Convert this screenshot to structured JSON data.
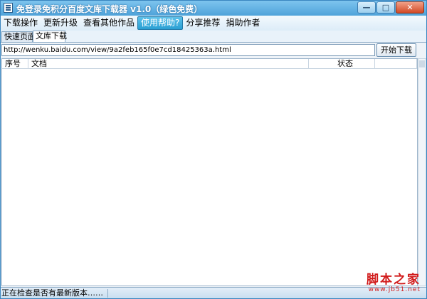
{
  "window": {
    "title": "免登录免积分百度文库下载器 v1.0（绿色免费）",
    "controls": [
      "—",
      "□",
      "✕"
    ]
  },
  "menu": {
    "items": [
      "下载操作",
      "更新升级",
      "查看其他作品",
      "使用帮助?",
      "分享推荐",
      "捐助作者"
    ],
    "active_index": 3
  },
  "tabs": [
    "快速页面",
    "文库下载"
  ],
  "toolbar": {
    "url_value": "http://wenku.baidu.com/view/9a2feb165f0e7cd18425363a.html",
    "start_button": "开始下载"
  },
  "table": {
    "headers": [
      "序号",
      "文档",
      "状态",
      ""
    ],
    "rows": []
  },
  "status": {
    "text": "正在检查是否有最新版本……"
  },
  "watermark": {
    "main": "脚本之家",
    "sub": "www.jb51.net"
  },
  "colors": {
    "title_bar": "#4fa3da",
    "menu_active": "#2a9fd3",
    "watermark": "#d11b1b"
  }
}
